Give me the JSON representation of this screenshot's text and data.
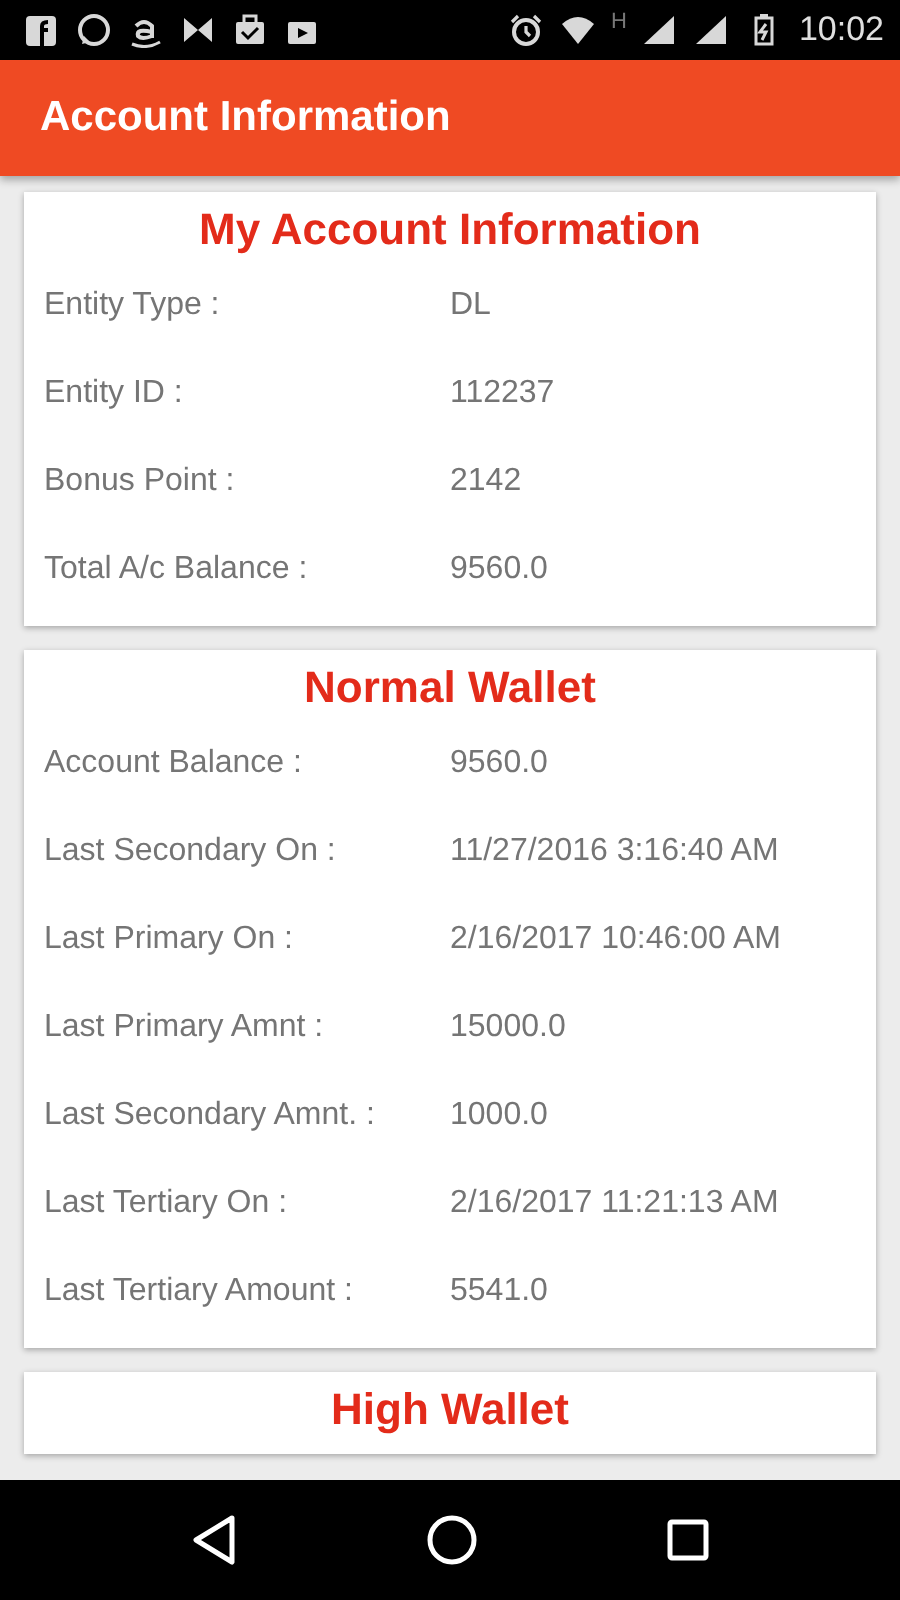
{
  "status_bar": {
    "network": "H",
    "time": "10:02"
  },
  "app_bar": {
    "title": "Account Information"
  },
  "cards": [
    {
      "title": "My Account Information",
      "rows": [
        {
          "label": "Entity Type :",
          "value": "DL"
        },
        {
          "label": "Entity ID :",
          "value": "112237"
        },
        {
          "label": "Bonus Point :",
          "value": "2142"
        },
        {
          "label": "Total A/c Balance :",
          "value": "9560.0"
        }
      ]
    },
    {
      "title": "Normal Wallet",
      "rows": [
        {
          "label": "Account Balance :",
          "value": "9560.0"
        },
        {
          "label": "Last Secondary On :",
          "value": "11/27/2016 3:16:40 AM"
        },
        {
          "label": "Last Primary On :",
          "value": "2/16/2017 10:46:00 AM"
        },
        {
          "label": "Last Primary Amnt :",
          "value": "15000.0"
        },
        {
          "label": "Last Secondary Amnt. :",
          "value": "1000.0"
        },
        {
          "label": "Last Tertiary On :",
          "value": "2/16/2017 11:21:13 AM"
        },
        {
          "label": "Last Tertiary Amount :",
          "value": "5541.0"
        }
      ]
    },
    {
      "title": "High Wallet"
    }
  ]
}
